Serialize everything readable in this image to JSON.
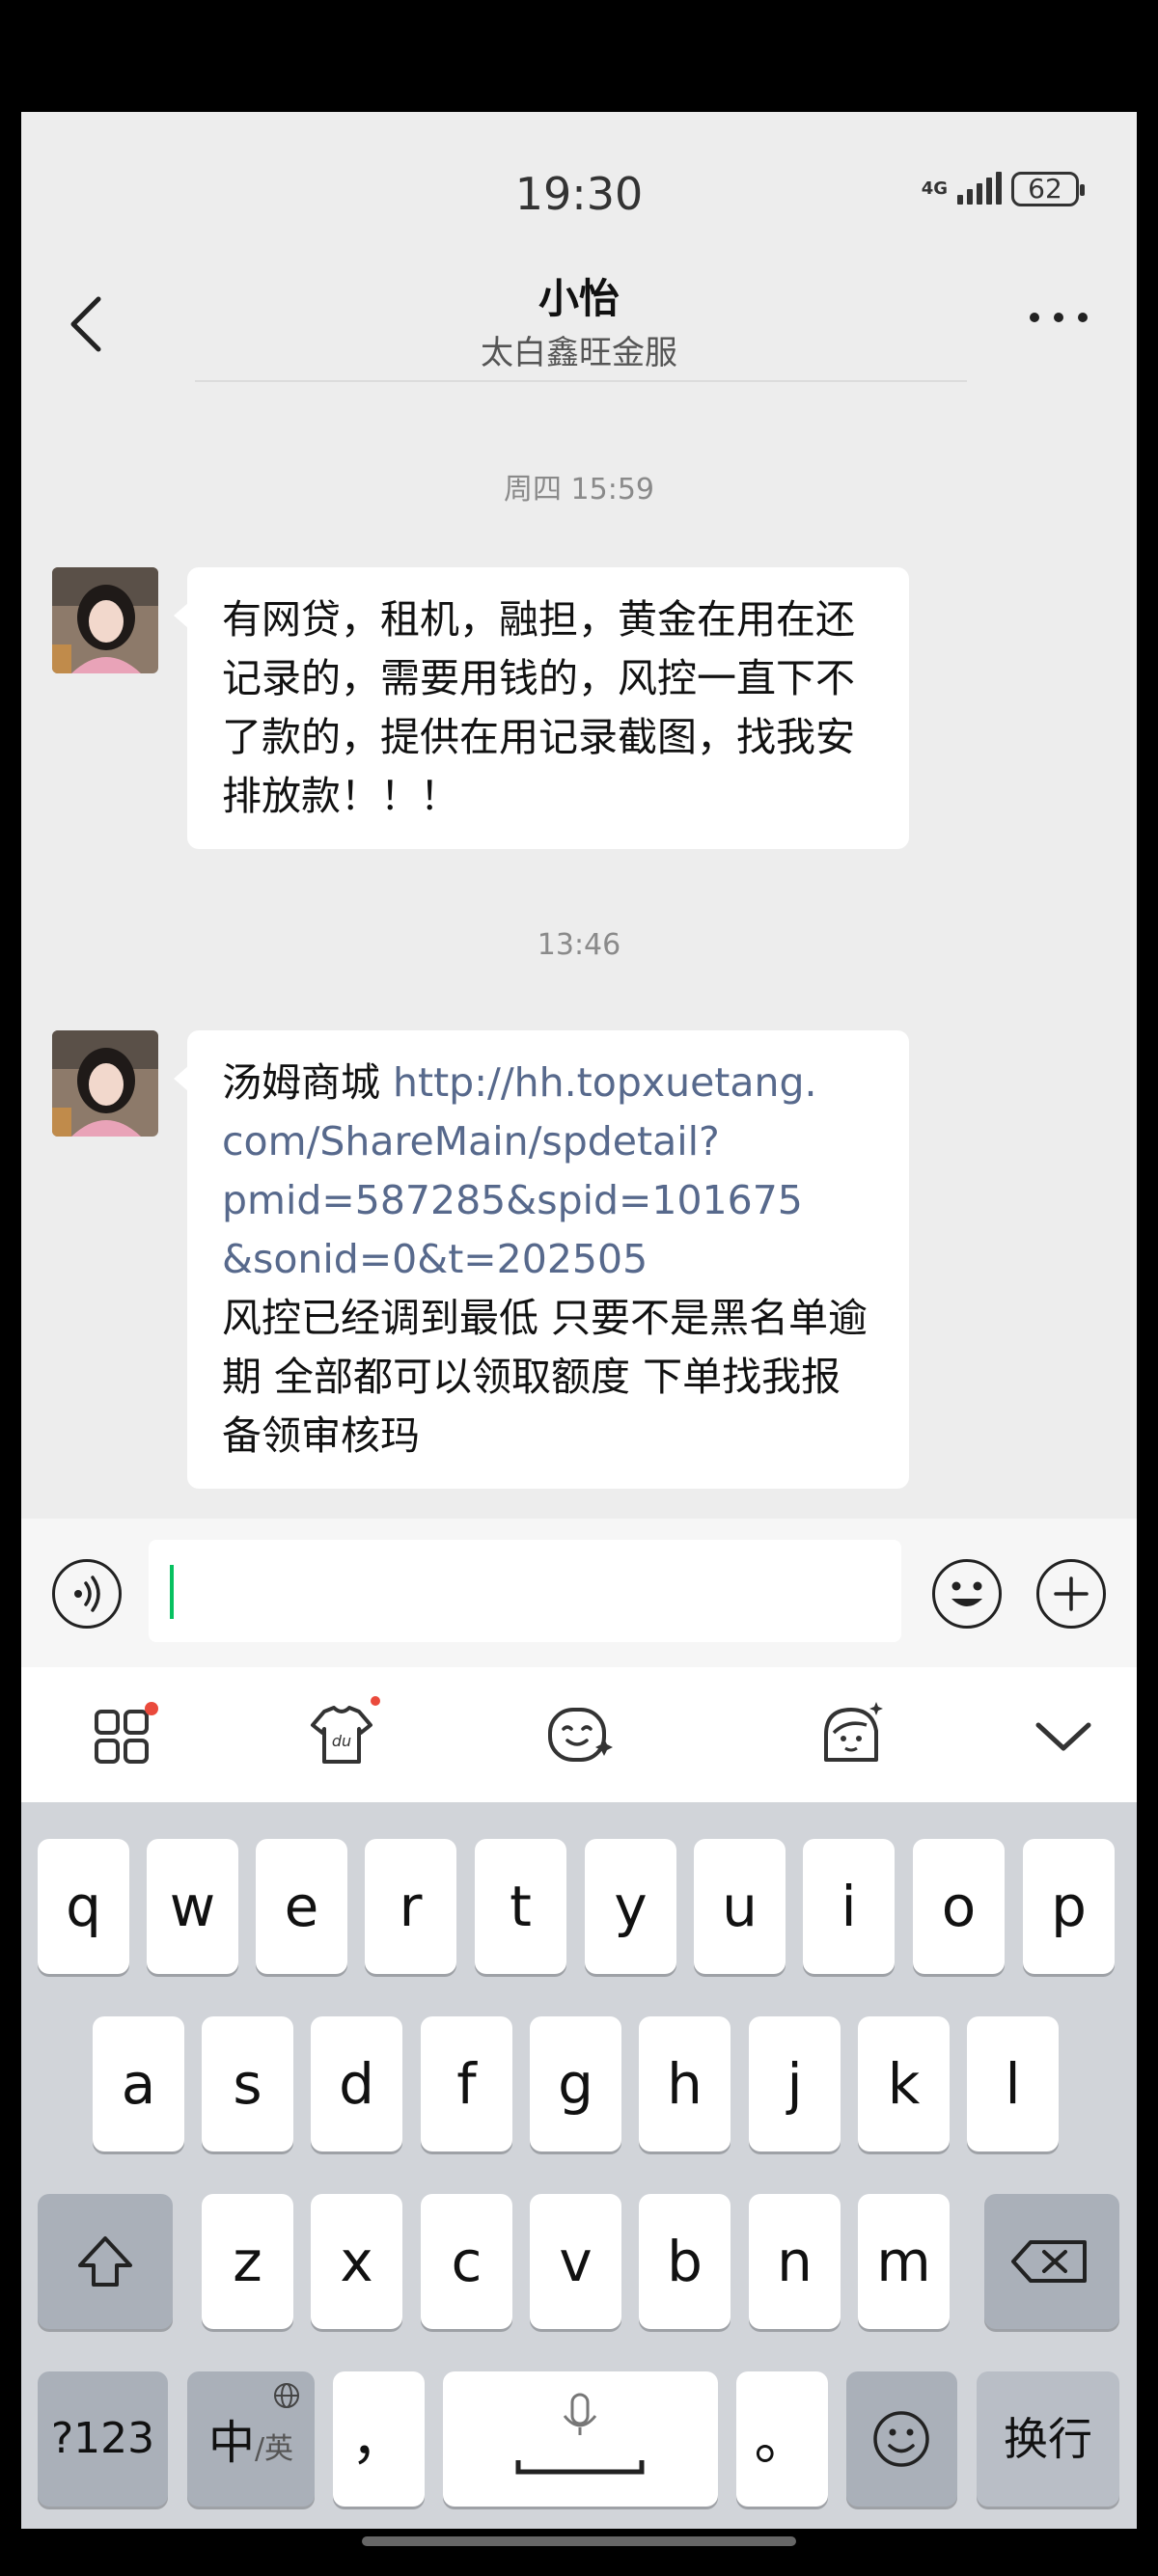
{
  "status_bar": {
    "time": "19:30",
    "network": "4G",
    "network_sub": "4G",
    "battery": "62"
  },
  "header": {
    "title": "小怡",
    "subtitle": "太白鑫旺金服"
  },
  "messages": [
    {
      "timestamp": "周四 15:59",
      "text": "有网贷，租机，融担，黄金在用在还记录的，需要用钱的，风控一直下不了款的，提供在用记录截图，找我安排放款！！！"
    },
    {
      "timestamp": "13:46",
      "text_prefix": "汤姆商城 ",
      "link": "http://hh.topxuetang.com/ShareMain/spdetail?pmid=587285&spid=101675&sonid=0&t=202505",
      "link_line1": "http://hh.topxuetang.",
      "link_line2": "com/ShareMain/spdetail?",
      "link_line3": "pmid=587285&spid=101675",
      "link_line4": "&sonid=0&t=202505",
      "text_suffix": "风控已经调到最低 只要不是黑名单逾期 全部都可以领取额度 下单找我报备领审核玛"
    }
  ],
  "input": {
    "value": ""
  },
  "keyboard": {
    "row1": [
      "q",
      "w",
      "e",
      "r",
      "t",
      "y",
      "u",
      "i",
      "o",
      "p"
    ],
    "row2": [
      "a",
      "s",
      "d",
      "f",
      "g",
      "h",
      "j",
      "k",
      "l"
    ],
    "row3": [
      "z",
      "x",
      "c",
      "v",
      "b",
      "n",
      "m"
    ],
    "numbers_key": "?123",
    "lang_key_main": "中",
    "lang_key_alt": "/英",
    "comma_key": "，",
    "period_key": "。",
    "enter_key": "换行"
  }
}
